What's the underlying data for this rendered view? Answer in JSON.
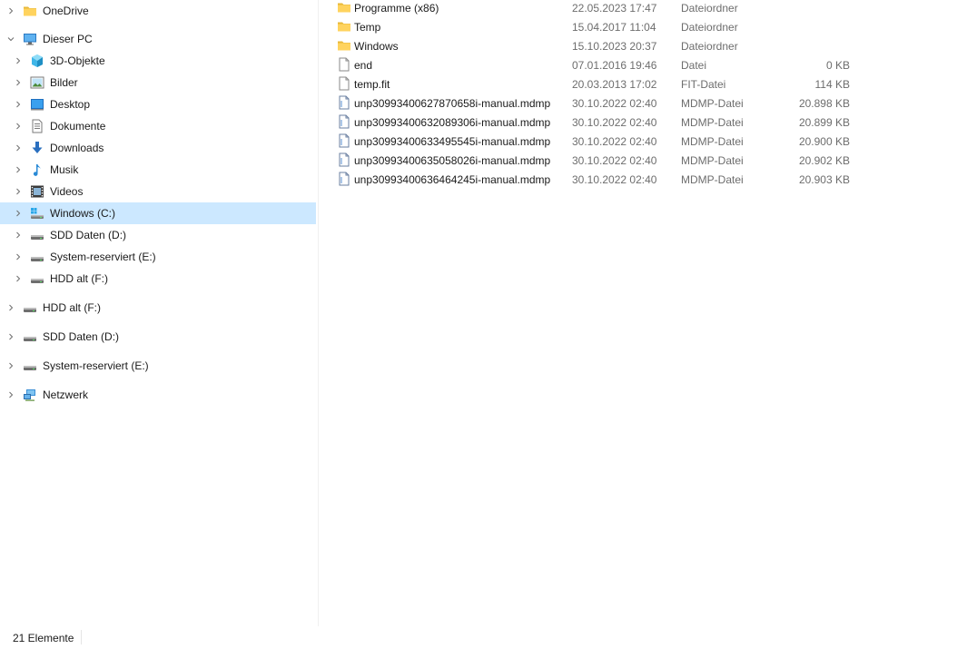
{
  "nav": {
    "items": [
      {
        "label": "OneDrive",
        "icon": "folder-icon",
        "level": 0,
        "expanded": false,
        "selected": false
      },
      {
        "label": "Dieser PC",
        "icon": "computer-icon",
        "level": 0,
        "expanded": true,
        "selected": false
      },
      {
        "label": "3D-Objekte",
        "icon": "3d-objects-icon",
        "level": 1,
        "expanded": false,
        "selected": false
      },
      {
        "label": "Bilder",
        "icon": "pictures-icon",
        "level": 1,
        "expanded": false,
        "selected": false
      },
      {
        "label": "Desktop",
        "icon": "desktop-icon",
        "level": 1,
        "expanded": false,
        "selected": false
      },
      {
        "label": "Dokumente",
        "icon": "documents-icon",
        "level": 1,
        "expanded": false,
        "selected": false
      },
      {
        "label": "Downloads",
        "icon": "downloads-icon",
        "level": 1,
        "expanded": false,
        "selected": false
      },
      {
        "label": "Musik",
        "icon": "music-icon",
        "level": 1,
        "expanded": false,
        "selected": false
      },
      {
        "label": "Videos",
        "icon": "videos-icon",
        "level": 1,
        "expanded": false,
        "selected": false
      },
      {
        "label": "Windows (C:)",
        "icon": "windows-drive-icon",
        "level": 1,
        "expanded": false,
        "selected": true
      },
      {
        "label": "SDD Daten (D:)",
        "icon": "drive-icon",
        "level": 1,
        "expanded": false,
        "selected": false
      },
      {
        "label": "System-reserviert (E:)",
        "icon": "drive-icon",
        "level": 1,
        "expanded": false,
        "selected": false
      },
      {
        "label": "HDD alt (F:)",
        "icon": "drive-icon",
        "level": 1,
        "expanded": false,
        "selected": false
      },
      {
        "label": "HDD alt (F:)",
        "icon": "drive-icon",
        "level": 0,
        "expanded": false,
        "selected": false
      },
      {
        "label": "SDD Daten (D:)",
        "icon": "drive-icon",
        "level": 0,
        "expanded": false,
        "selected": false
      },
      {
        "label": "System-reserviert (E:)",
        "icon": "drive-icon",
        "level": 0,
        "expanded": false,
        "selected": false
      },
      {
        "label": "Netzwerk",
        "icon": "network-icon",
        "level": 0,
        "expanded": false,
        "selected": false
      }
    ]
  },
  "files": {
    "rows": [
      {
        "name": "Programme (x86)",
        "date": "22.05.2023 17:47",
        "type": "Dateiordner",
        "size": "",
        "icon": "folder-icon"
      },
      {
        "name": "Temp",
        "date": "15.04.2017 11:04",
        "type": "Dateiordner",
        "size": "",
        "icon": "folder-icon"
      },
      {
        "name": "Windows",
        "date": "15.10.2023 20:37",
        "type": "Dateiordner",
        "size": "",
        "icon": "folder-icon"
      },
      {
        "name": "end",
        "date": "07.01.2016 19:46",
        "type": "Datei",
        "size": "0 KB",
        "icon": "file-icon"
      },
      {
        "name": "temp.fit",
        "date": "20.03.2013 17:02",
        "type": "FIT-Datei",
        "size": "114 KB",
        "icon": "file-icon"
      },
      {
        "name": "unp30993400627870658i-manual.mdmp",
        "date": "30.10.2022 02:40",
        "type": "MDMP-Datei",
        "size": "20.898 KB",
        "icon": "dump-file-icon"
      },
      {
        "name": "unp30993400632089306i-manual.mdmp",
        "date": "30.10.2022 02:40",
        "type": "MDMP-Datei",
        "size": "20.899 KB",
        "icon": "dump-file-icon"
      },
      {
        "name": "unp30993400633495545i-manual.mdmp",
        "date": "30.10.2022 02:40",
        "type": "MDMP-Datei",
        "size": "20.900 KB",
        "icon": "dump-file-icon"
      },
      {
        "name": "unp30993400635058026i-manual.mdmp",
        "date": "30.10.2022 02:40",
        "type": "MDMP-Datei",
        "size": "20.902 KB",
        "icon": "dump-file-icon"
      },
      {
        "name": "unp30993400636464245i-manual.mdmp",
        "date": "30.10.2022 02:40",
        "type": "MDMP-Datei",
        "size": "20.903 KB",
        "icon": "dump-file-icon"
      }
    ]
  },
  "status": {
    "item_count": "21 Elemente"
  },
  "colors": {
    "selection": "#cce8ff",
    "folder": "#ffd35e",
    "secondary_text": "#6d6d6d"
  }
}
